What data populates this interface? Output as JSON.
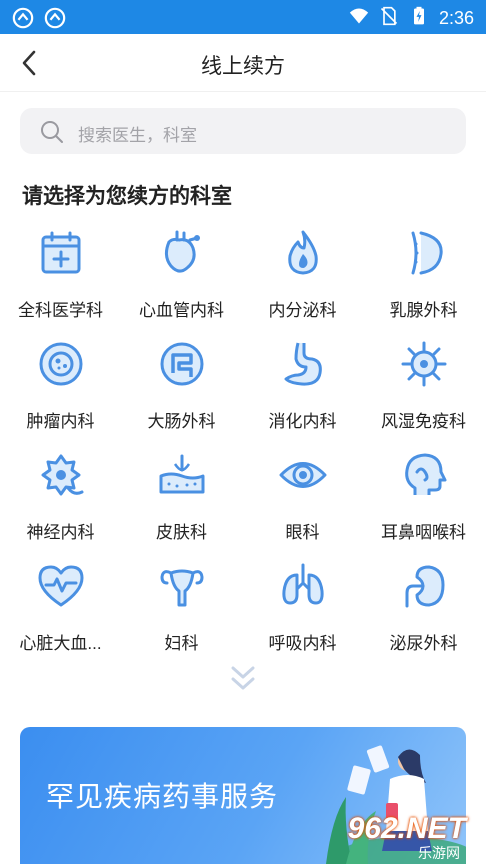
{
  "status_bar": {
    "time": "2:36"
  },
  "header": {
    "title": "线上续方"
  },
  "search": {
    "placeholder": "搜索医生，科室"
  },
  "section": {
    "title": "请选择为您续方的科室"
  },
  "departments": [
    {
      "label": "全科医学科",
      "icon": "calendar-plus-icon"
    },
    {
      "label": "心血管内科",
      "icon": "heart-organ-icon"
    },
    {
      "label": "内分泌科",
      "icon": "flame-drop-icon"
    },
    {
      "label": "乳腺外科",
      "icon": "breast-icon"
    },
    {
      "label": "肿瘤内科",
      "icon": "cell-icon"
    },
    {
      "label": "大肠外科",
      "icon": "intestine-icon"
    },
    {
      "label": "消化内科",
      "icon": "stomach-icon"
    },
    {
      "label": "风湿免疫科",
      "icon": "virus-icon"
    },
    {
      "label": "神经内科",
      "icon": "neuron-icon"
    },
    {
      "label": "皮肤科",
      "icon": "skin-icon"
    },
    {
      "label": "眼科",
      "icon": "eye-icon"
    },
    {
      "label": "耳鼻咽喉科",
      "icon": "head-profile-icon"
    },
    {
      "label": "心脏大血...",
      "icon": "heart-pulse-icon"
    },
    {
      "label": "妇科",
      "icon": "uterus-icon"
    },
    {
      "label": "呼吸内科",
      "icon": "lungs-icon"
    },
    {
      "label": "泌尿外科",
      "icon": "kidney-icon"
    }
  ],
  "banner": {
    "text": "罕见疾病药事服务"
  },
  "watermark": {
    "text": "962.NET",
    "sub": "乐游网"
  },
  "colors": {
    "accent": "#1e88e5",
    "icon_blue": "#4a90e2"
  }
}
